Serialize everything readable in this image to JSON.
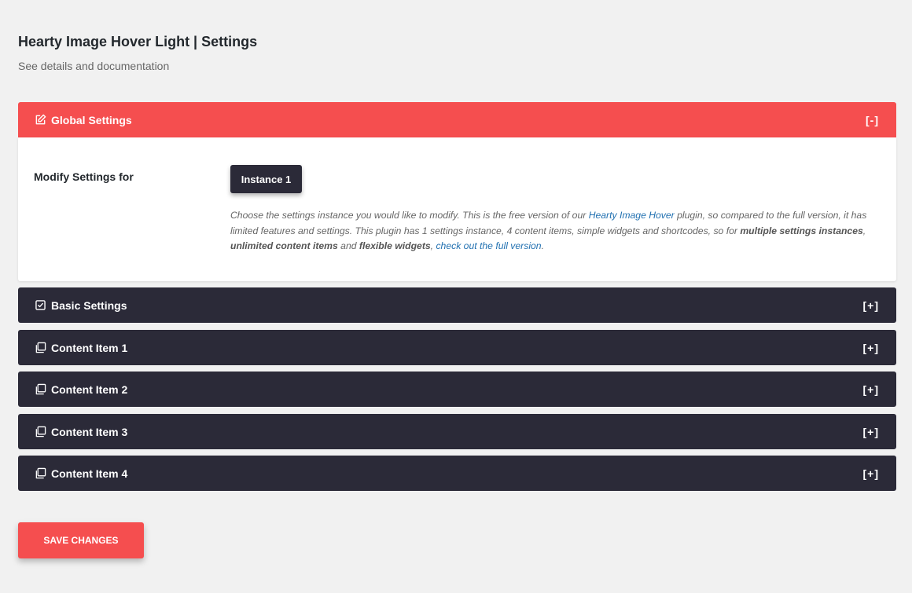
{
  "header": {
    "title": "Hearty Image Hover Light | Settings",
    "subtitle": "See details and documentation"
  },
  "colors": {
    "accent": "#f54e4f",
    "dark": "#2b2a38",
    "link": "#2271b1"
  },
  "global_settings": {
    "title": "Global Settings",
    "icon": "edit-icon",
    "toggle": "[-]",
    "field_label": "Modify Settings for",
    "instance_button": "Instance 1",
    "description": {
      "p1": "Choose the settings instance you would like to modify. This is the free version of our ",
      "link1": "Hearty Image Hover",
      "p2": " plugin, so compared to the full version, it has limited features and settings. This plugin has 1 settings instance, 4 content items, simple widgets and shortcodes, so for ",
      "b1": "multiple settings instances",
      "p3": ", ",
      "b2": "unlimited content items",
      "p4": " and ",
      "b3": "flexible widgets",
      "p5": ", ",
      "link2": "check out the full version",
      "p6": "."
    }
  },
  "panels": [
    {
      "title": "Basic Settings",
      "icon": "checkbox-icon",
      "toggle": "[+]"
    },
    {
      "title": "Content Item 1",
      "icon": "copy-icon",
      "toggle": "[+]"
    },
    {
      "title": "Content Item 2",
      "icon": "copy-icon",
      "toggle": "[+]"
    },
    {
      "title": "Content Item 3",
      "icon": "copy-icon",
      "toggle": "[+]"
    },
    {
      "title": "Content Item 4",
      "icon": "copy-icon",
      "toggle": "[+]"
    }
  ],
  "footer": {
    "save_label": "SAVE CHANGES"
  }
}
